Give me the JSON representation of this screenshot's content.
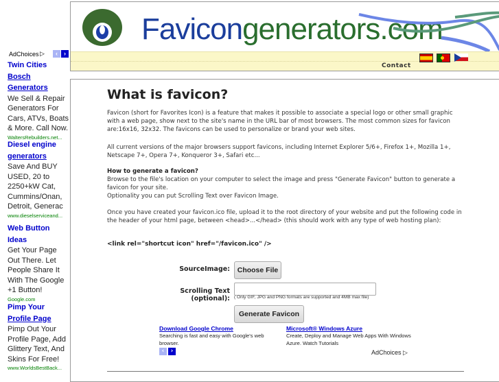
{
  "header": {
    "brand_part1": "Favicon",
    "brand_part2": "generators.com",
    "contact_label": "Contact",
    "flags": [
      {
        "name": "spanish",
        "label": "Spanish"
      },
      {
        "name": "portuguese",
        "label": "Portuguese"
      },
      {
        "name": "czech",
        "label": "Czech"
      }
    ]
  },
  "left_ads": {
    "adchoices_label": "AdChoices",
    "adchoices_icon": "▷",
    "prev_icon": "‹",
    "next_icon": "›",
    "items": [
      {
        "title_line1": "Twin Cities",
        "title_line2": "Bosch",
        "title_line3": "Generators",
        "body": "We Sell & Repair Generators For Cars, ATVs, Boats & More. Call Now.",
        "url": "WaltersRebuilders.net..."
      },
      {
        "title_line1": "Diesel engine",
        "title_line2": "generators",
        "body": "Save And BUY USED, 20 to 2250+kW Cat, Cummins/Onan, Detroit, Generac",
        "url": "www.dieselserviceand..."
      },
      {
        "title_line1": "Web Button Ideas",
        "body": "Get Your Page Out There. Let People Share It With The Google +1 Button!",
        "url": "Google.com"
      },
      {
        "title_line1": "Pimp Your",
        "title_line2": "Profile Page",
        "body": "Pimp Out Your Profile Page, Add Glittery Text, And Skins For Free!",
        "url": "www.WorldsBestBack..."
      }
    ]
  },
  "main": {
    "title": "What is favicon?",
    "para1": "Favicon (short for Favorites Icon) is a feature that makes it possible to associate a special logo or other small graphic with a web page, show next to the site's name in the URL bar of most browsers. The most common sizes for favicon are:16x16, 32x32. The favicons can be used to personalize or brand your web sites.",
    "para2": "All current versions of the major browsers support favicons, including Internet Explorer 5/6+, Firefox 1+, Mozilla 1+, Netscape 7+, Opera 7+, Konqueror 3+, Safari etc...",
    "howto_heading": "How to generate a favicon?",
    "howto_line1": "Browse to the file's location on your computer to select the image and press \"Generate Favicon\" button to generate a favicon for your site.",
    "howto_line2": "Optionality you can put Scrolling Text over Favicon Image.",
    "para4": "Once you have created your favicon.ico file, upload it to the root directory of your website and put the following code in the header of your html page, between <head>...</head> (this should work with any type of web hosting plan):",
    "code": "<link rel=\"shortcut icon\" href=\"/favicon.ico\" />"
  },
  "form": {
    "source_label": "SourceImage:",
    "choose_file_label": "Choose File",
    "scrolling_label": "Scrolling Text (optional):",
    "scrolling_value": "",
    "hint": "( Only GIF, JPG and PNG formats are supported and 4MB max file)",
    "generate_label": "Generate Favicon"
  },
  "bottom_ads": {
    "items": [
      {
        "title": "Download Google Chrome",
        "body": "Searching is fast and easy with Google's web browser."
      },
      {
        "title": "Microsoft® Windows Azure",
        "body": "Create, Deploy and Manage Web Apps With Windows Azure. Watch Tutorials"
      }
    ],
    "adchoices_label": "AdChoices",
    "adchoices_icon": "▷",
    "prev_icon": "‹",
    "next_icon": "›"
  },
  "colors": {
    "ad_title": "#0000cc",
    "ad_url": "#008000",
    "nav_strip": "#fbf7c8",
    "brand_blue": "#1b3e9c",
    "brand_green": "#2a6e2e"
  }
}
